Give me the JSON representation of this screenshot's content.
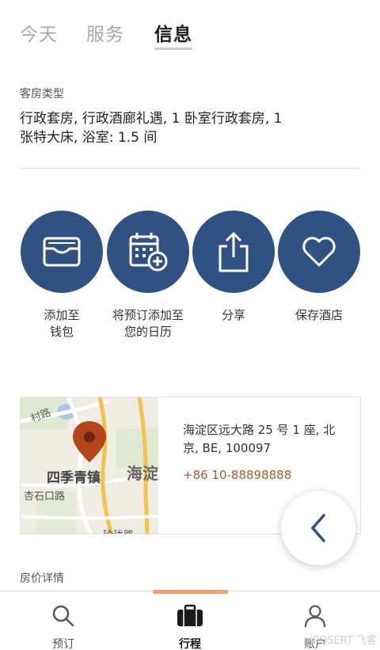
{
  "tabs": [
    {
      "label": "今天"
    },
    {
      "label": "服务"
    },
    {
      "label": "信息"
    }
  ],
  "room": {
    "label": "客房类型",
    "description": "行政套房, 行政酒廊礼遇, 1 卧室行政套房, 1  张特大床, 浴室: 1.5 间"
  },
  "actions": [
    {
      "label": "添加至\n钱包",
      "icon": "wallet-icon"
    },
    {
      "label": "将预订添加至\n您的日历",
      "icon": "calendar-add-icon"
    },
    {
      "label": "分享",
      "icon": "share-icon"
    },
    {
      "label": "保存酒店",
      "icon": "heart-icon"
    }
  ],
  "hotel": {
    "address": "海淀区远大路 25 号 1 座, 北京, BE, 100097",
    "phone": "+86 10-88898888",
    "map_labels": {
      "top_road": "村路",
      "district": "四季青镇",
      "district_right": "海淀",
      "street": "杏石口路",
      "bottom_road": "玲珑路"
    }
  },
  "price_label": "房价详情",
  "bottom_nav": [
    {
      "label": "预订",
      "icon": "search-icon"
    },
    {
      "label": "行程",
      "icon": "suitcase-icon"
    },
    {
      "label": "账户",
      "icon": "person-icon"
    }
  ],
  "watermark": "iPOSERT 飞客",
  "colors": {
    "accent": "#2f5282",
    "phone": "#b4572a",
    "indicator": "#f2a071",
    "pin": "#b4451b"
  }
}
